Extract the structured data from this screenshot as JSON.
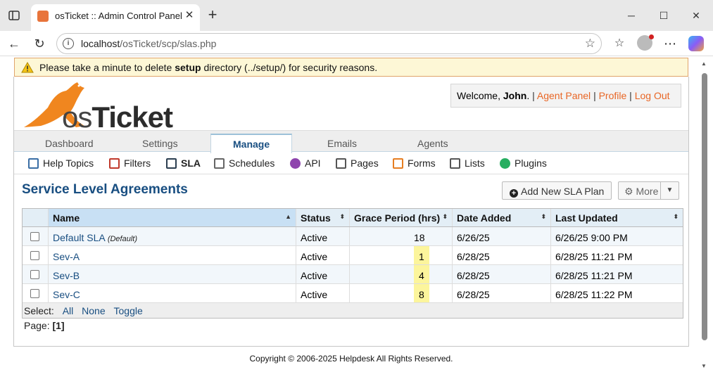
{
  "browser": {
    "tab_title": "osTicket :: Admin Control Panel",
    "url_host": "localhost",
    "url_path": "/osTicket/scp/slas.php"
  },
  "warning": {
    "prefix": "Please take a minute to delete ",
    "bold": "setup",
    "suffix": " directory (../setup/) for security reasons."
  },
  "brand": {
    "logo_os": "os",
    "logo_ticket": "Ticket"
  },
  "user_bar": {
    "welcome_prefix": "Welcome, ",
    "user_name": "John",
    "welcome_suffix": ".",
    "agent_panel": "Agent Panel",
    "profile": "Profile",
    "logout": "Log Out"
  },
  "nav_tabs": [
    "Dashboard",
    "Settings",
    "Manage",
    "Emails",
    "Agents"
  ],
  "subnav": [
    {
      "label": "Help Topics",
      "icon": "help-topics-icon",
      "color": "#3a6ea5"
    },
    {
      "label": "Filters",
      "icon": "filters-icon",
      "color": "#c0392b"
    },
    {
      "label": "SLA",
      "icon": "sla-icon",
      "color": "#2c3e50"
    },
    {
      "label": "Schedules",
      "icon": "schedules-icon",
      "color": "#666666"
    },
    {
      "label": "API",
      "icon": "api-icon",
      "color": "#8e44ad"
    },
    {
      "label": "Pages",
      "icon": "pages-icon",
      "color": "#555555"
    },
    {
      "label": "Forms",
      "icon": "forms-icon",
      "color": "#e67e22"
    },
    {
      "label": "Lists",
      "icon": "lists-icon",
      "color": "#555555"
    },
    {
      "label": "Plugins",
      "icon": "plugins-icon",
      "color": "#27ae60"
    }
  ],
  "main": {
    "title": "Service Level Agreements",
    "add_button": "Add New SLA Plan",
    "more_button": "More"
  },
  "table": {
    "headers": [
      "Name",
      "Status",
      "Grace Period (hrs)",
      "Date Added",
      "Last Updated"
    ],
    "rows": [
      {
        "name": "Default SLA",
        "tag": "(Default)",
        "status": "Active",
        "grace": "18",
        "added": "6/26/25",
        "updated": "6/26/25 9:00 PM",
        "highlight": false
      },
      {
        "name": "Sev-A",
        "tag": "",
        "status": "Active",
        "grace": "1",
        "added": "6/28/25",
        "updated": "6/28/25 11:21 PM",
        "highlight": true
      },
      {
        "name": "Sev-B",
        "tag": "",
        "status": "Active",
        "grace": "4",
        "added": "6/28/25",
        "updated": "6/28/25 11:21 PM",
        "highlight": true
      },
      {
        "name": "Sev-C",
        "tag": "",
        "status": "Active",
        "grace": "8",
        "added": "6/28/25",
        "updated": "6/28/25 11:22 PM",
        "highlight": true
      }
    ],
    "select_label": "Select:",
    "select_all": "All",
    "select_none": "None",
    "select_toggle": "Toggle"
  },
  "pager": {
    "label": "Page:",
    "current": "[1]"
  },
  "footer": {
    "copyright": "Copyright © 2006-2025 Helpdesk All Rights Reserved."
  },
  "colors": {
    "accent": "#184e81",
    "orange": "#e86625",
    "highlight": "#fcf59c"
  }
}
